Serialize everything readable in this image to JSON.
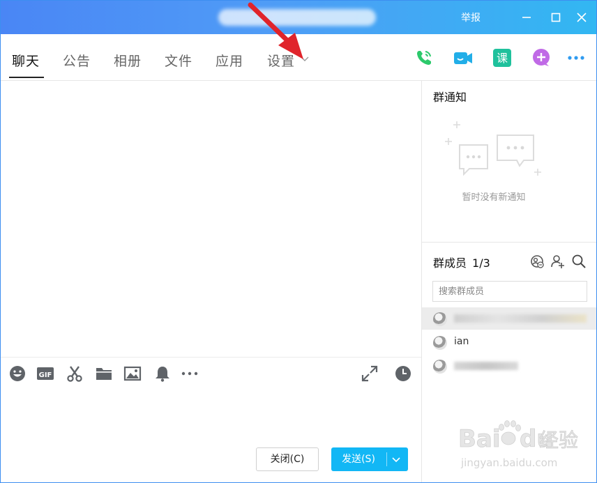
{
  "window": {
    "title": "",
    "report_label": "举报"
  },
  "tabs": [
    {
      "label": "聊天",
      "active": true
    },
    {
      "label": "公告"
    },
    {
      "label": "相册"
    },
    {
      "label": "文件"
    },
    {
      "label": "应用"
    },
    {
      "label": "设置"
    }
  ],
  "colors": {
    "titlebar_start": "#4a86f5",
    "titlebar_end": "#32b7f2",
    "phone": "#2cc96b",
    "video": "#22aee8",
    "lesson": "#1fc19c",
    "plus": "#c06ae6",
    "send": "#12b7f5",
    "annotation_arrow": "#e0242b"
  },
  "toolbar_icons": [
    "phone-call-icon",
    "video-call-icon",
    "lesson-icon",
    "add-app-icon",
    "more-icon"
  ],
  "input_toolbar_icons": [
    "emoji-icon",
    "gif-icon",
    "screenshot-scissors-icon",
    "folder-icon",
    "image-icon",
    "bell-icon",
    "more-icon",
    "expand-icon",
    "history-clock-icon"
  ],
  "lesson_glyph": "课",
  "gif_glyph": "GIF",
  "buttons": {
    "close_label": "关闭(C)",
    "send_label": "发送(S)"
  },
  "notice": {
    "title": "群通知",
    "empty_text": "暂时没有新通知"
  },
  "members": {
    "title": "群成员",
    "count": "1/3",
    "search_placeholder": "搜索群成员",
    "list": [
      {
        "name": "",
        "selected": true
      },
      {
        "name": "ian",
        "selected": false
      },
      {
        "name": "",
        "selected": false
      }
    ]
  },
  "watermark": {
    "brand": "Bai",
    "brand_suffix": "du",
    "cn": "经验",
    "url": "jingyan.baidu.com"
  }
}
